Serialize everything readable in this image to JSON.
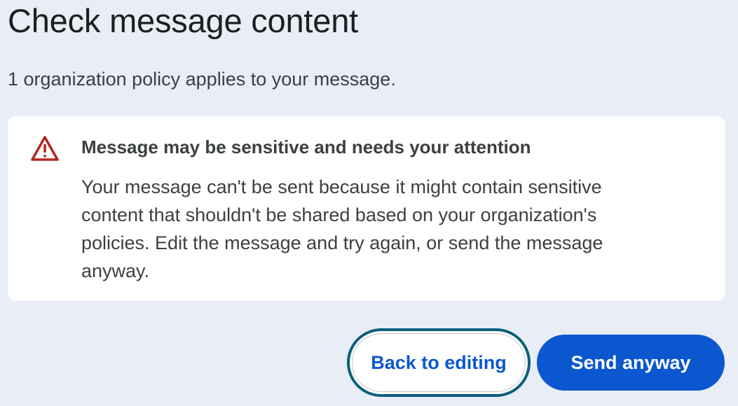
{
  "dialog": {
    "title": "Check message content",
    "subtitle": "1 organization policy applies to your message."
  },
  "policy": {
    "icon": "warning-icon",
    "icon_color": "#b3261e",
    "heading": "Message may be sensitive and needs your attention",
    "body": "Your message can't be sent because it might contain sensitive content that shouldn't be shared based on your organization's policies. Edit the message and try again, or send the message anyway."
  },
  "actions": {
    "back_label": "Back to editing",
    "send_label": "Send anyway"
  },
  "colors": {
    "background": "#e8edf6",
    "card": "#ffffff",
    "primary": "#0b57d0",
    "focus_ring": "#0b5f7d"
  }
}
